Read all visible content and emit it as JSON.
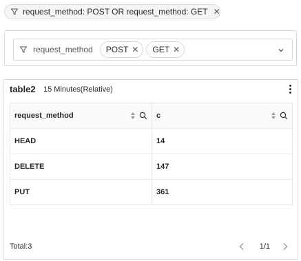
{
  "filter_pill": {
    "icon": "funnel-icon",
    "text": "request_method: POST OR request_method: GET",
    "close_icon": "close-icon"
  },
  "variable": {
    "label": "request_method",
    "tags": [
      {
        "label": "POST"
      },
      {
        "label": "GET"
      }
    ],
    "dropdown_icon": "chevron-down-icon"
  },
  "panel": {
    "title": "table2",
    "time_range": "15 Minutes(Relative)",
    "menu_icon": "more-vertical-icon",
    "columns": [
      {
        "label": "request_method"
      },
      {
        "label": "c"
      }
    ],
    "rows": [
      {
        "request_method": "HEAD",
        "c": "14"
      },
      {
        "request_method": "DELETE",
        "c": "147"
      },
      {
        "request_method": "PUT",
        "c": "361"
      }
    ],
    "footer": {
      "total": "Total:3",
      "page": "1/1"
    }
  }
}
